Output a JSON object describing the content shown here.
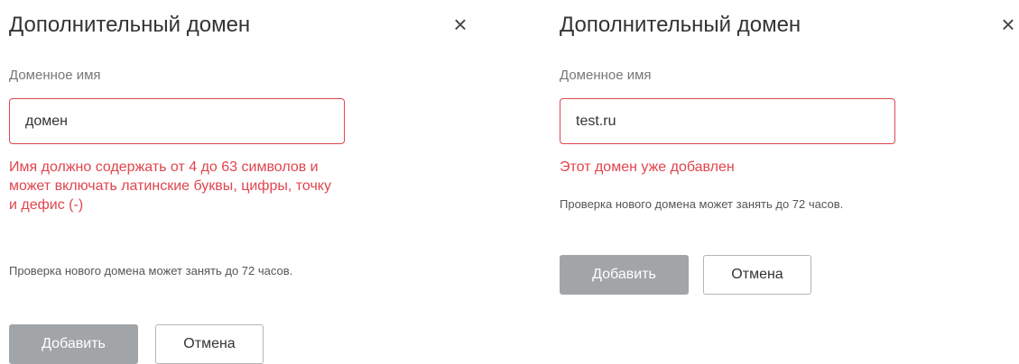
{
  "colors": {
    "error": "#e0454e",
    "primary_button_bg": "#a1a5a8",
    "secondary_button_border": "#b5b5b5",
    "label": "#777777"
  },
  "dialogs": [
    {
      "title": "Дополнительный домен",
      "close_icon": "×",
      "field_label": "Доменное имя",
      "input_value": "домен",
      "error_text": "Имя должно содержать от 4 до 63 символов и может включать латинские буквы, цифры, точку и дефис (-)",
      "hint": "Проверка нового домена может занять до 72 часов.",
      "add_label": "Добавить",
      "cancel_label": "Отмена"
    },
    {
      "title": "Дополнительный домен",
      "close_icon": "×",
      "field_label": "Доменное имя",
      "input_value": "test.ru",
      "error_text": "Этот домен уже добавлен",
      "hint": "Проверка нового домена может занять до 72 часов.",
      "add_label": "Добавить",
      "cancel_label": "Отмена"
    }
  ]
}
